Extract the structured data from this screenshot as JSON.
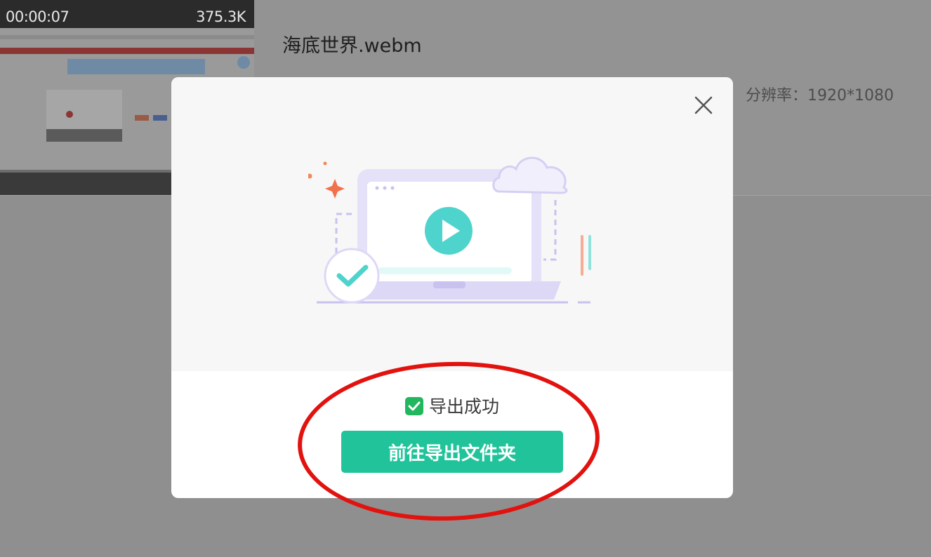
{
  "file_item": {
    "thumbnail": {
      "duration": "00:00:07",
      "size": "375.3K"
    },
    "file_name": "海底世界.webm",
    "resolution": "分辨率：1920*1080"
  },
  "dialog": {
    "close_icon": "close-icon",
    "illustration": "laptop-play-cloud-illustration",
    "status_icon": "green-checkbox-icon",
    "status_text": "导出成功",
    "open_folder_label": "前往导出文件夹"
  },
  "colors": {
    "overlay": "#8f8f8f",
    "primary_button": "#21c49a",
    "success_check": "#22b75e",
    "annotation_ellipse": "#e2120e"
  }
}
